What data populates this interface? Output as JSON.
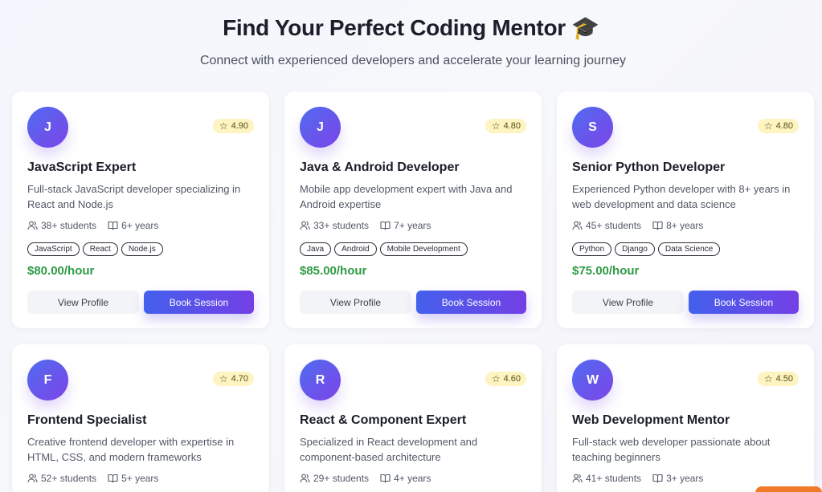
{
  "header": {
    "title": "Find Your Perfect Coding Mentor 🎓",
    "subtitle": "Connect with experienced developers and accelerate your learning journey"
  },
  "mentors": [
    {
      "initial": "J",
      "rating": "4.90",
      "name": "JavaScript Expert",
      "description": "Full-stack JavaScript developer specializing in React and Node.js",
      "students": "38+ students",
      "experience": "6+ years",
      "tags": [
        "JavaScript",
        "React",
        "Node.js"
      ],
      "price": "$80.00/hour",
      "view_label": "View Profile",
      "book_label": "Book Session"
    },
    {
      "initial": "J",
      "rating": "4.80",
      "name": "Java & Android Developer",
      "description": "Mobile app development expert with Java and Android expertise",
      "students": "33+ students",
      "experience": "7+ years",
      "tags": [
        "Java",
        "Android",
        "Mobile Development"
      ],
      "price": "$85.00/hour",
      "view_label": "View Profile",
      "book_label": "Book Session"
    },
    {
      "initial": "S",
      "rating": "4.80",
      "name": "Senior Python Developer",
      "description": "Experienced Python developer with 8+ years in web development and data science",
      "students": "45+ students",
      "experience": "8+ years",
      "tags": [
        "Python",
        "Django",
        "Data Science"
      ],
      "price": "$75.00/hour",
      "view_label": "View Profile",
      "book_label": "Book Session"
    },
    {
      "initial": "F",
      "rating": "4.70",
      "name": "Frontend Specialist",
      "description": "Creative frontend developer with expertise in HTML, CSS, and modern frameworks",
      "students": "52+ students",
      "experience": "5+ years"
    },
    {
      "initial": "R",
      "rating": "4.60",
      "name": "React & Component Expert",
      "description": "Specialized in React development and component-based architecture",
      "students": "29+ students",
      "experience": "4+ years"
    },
    {
      "initial": "W",
      "rating": "4.50",
      "name": "Web Development Mentor",
      "description": "Full-stack web developer passionate about teaching beginners",
      "students": "41+ students",
      "experience": "3+ years"
    }
  ],
  "colors": {
    "accent_start": "#4460ec",
    "accent_end": "#7340e6",
    "price": "#2e9a45",
    "rating_bg": "#fdf4c2"
  },
  "icons": {
    "rating": "star-icon",
    "students": "users-icon",
    "experience": "book-icon"
  }
}
